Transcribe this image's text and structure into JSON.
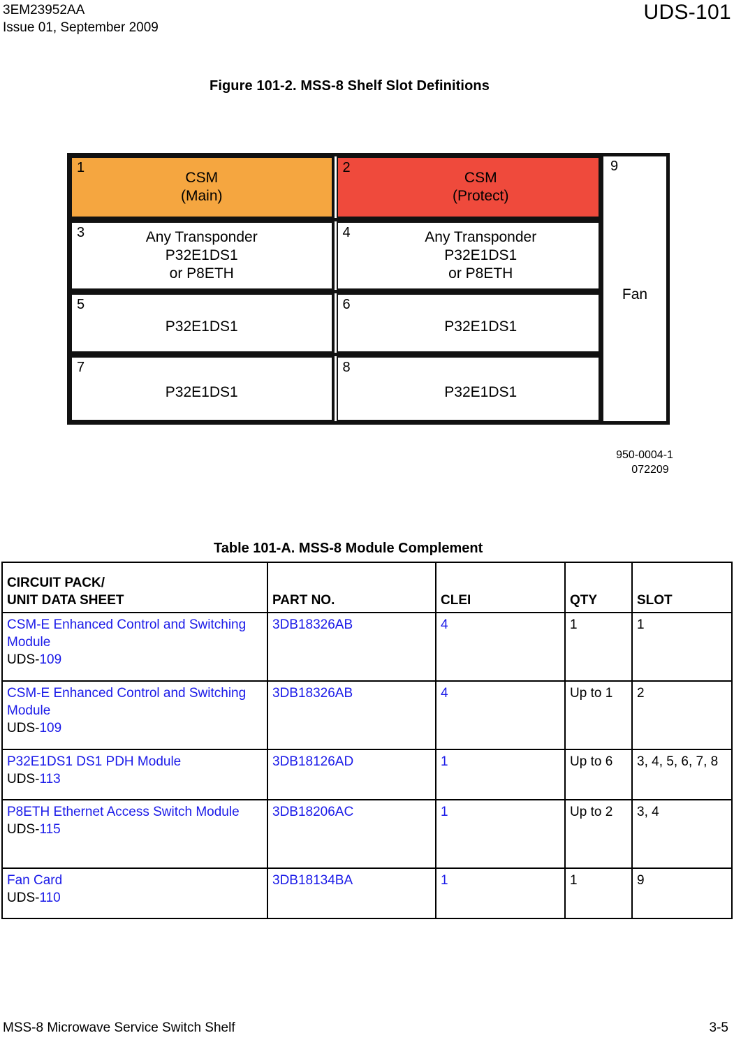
{
  "header": {
    "doc_id": "3EM23952AA",
    "issue": "Issue 01, September 2009",
    "section_id": "UDS-101"
  },
  "figure": {
    "title": "Figure 101-2. MSS-8 Shelf Slot Definitions",
    "source_line1": "950-0004-1",
    "source_line2": "072209",
    "colors": {
      "csm_main_fill": "#F5A640",
      "csm_protect_fill": "#EF4A3C",
      "border": "#111111"
    },
    "slots": [
      {
        "num": "1",
        "line1": "CSM",
        "line2": "(Main)",
        "line3": ""
      },
      {
        "num": "2",
        "line1": "CSM",
        "line2": "(Protect)",
        "line3": ""
      },
      {
        "num": "3",
        "line1": "Any Transponder",
        "line2": "P32E1DS1",
        "line3": "or P8ETH"
      },
      {
        "num": "4",
        "line1": "Any Transponder",
        "line2": "P32E1DS1",
        "line3": "or P8ETH"
      },
      {
        "num": "5",
        "line1": "P32E1DS1",
        "line2": "",
        "line3": ""
      },
      {
        "num": "6",
        "line1": "P32E1DS1",
        "line2": "",
        "line3": ""
      },
      {
        "num": "7",
        "line1": "P32E1DS1",
        "line2": "",
        "line3": ""
      },
      {
        "num": "8",
        "line1": "P32E1DS1",
        "line2": "",
        "line3": ""
      }
    ],
    "fan": {
      "num": "9",
      "label": "Fan"
    }
  },
  "table": {
    "title": "Table 101-A. MSS-8 Module Complement",
    "headers": {
      "unit_l1": "CIRCUIT PACK/",
      "unit_l2": "UNIT DATA SHEET",
      "part": "PART NO.",
      "clei": "CLEI",
      "qty": "QTY",
      "slot": "SLOT"
    },
    "rows": [
      {
        "unit_name": "CSM-E Enhanced Control and Switching Module",
        "uds_prefix": "UDS-",
        "uds_number": "109",
        "part_no": "3DB18326AB",
        "clei": "4",
        "qty": "1",
        "slot": "1"
      },
      {
        "unit_name": "CSM-E Enhanced Control and Switching Module",
        "uds_prefix": "UDS-",
        "uds_number": "109",
        "part_no": "3DB18326AB",
        "clei": "4",
        "qty": "Up to 1",
        "slot": "2"
      },
      {
        "unit_name": "P32E1DS1 DS1 PDH Module",
        "uds_prefix": "UDS-",
        "uds_number": "113",
        "part_no": "3DB18126AD",
        "clei": "1",
        "qty": "Up to 6",
        "slot": "3, 4, 5, 6, 7, 8"
      },
      {
        "unit_name": "P8ETH Ethernet Access Switch Module",
        "uds_prefix": "UDS-",
        "uds_number": "115",
        "part_no": "3DB18206AC",
        "clei": "1",
        "qty": "Up to 2",
        "slot": "3, 4"
      },
      {
        "unit_name": "Fan Card",
        "uds_prefix": "UDS-",
        "uds_number": "110",
        "part_no": "3DB18134BA",
        "clei": "1",
        "qty": "1",
        "slot": "9"
      }
    ],
    "link_color": "#1a1ae8"
  },
  "footer": {
    "left": "MSS-8 Microwave Service Switch Shelf",
    "page": "3-5"
  }
}
